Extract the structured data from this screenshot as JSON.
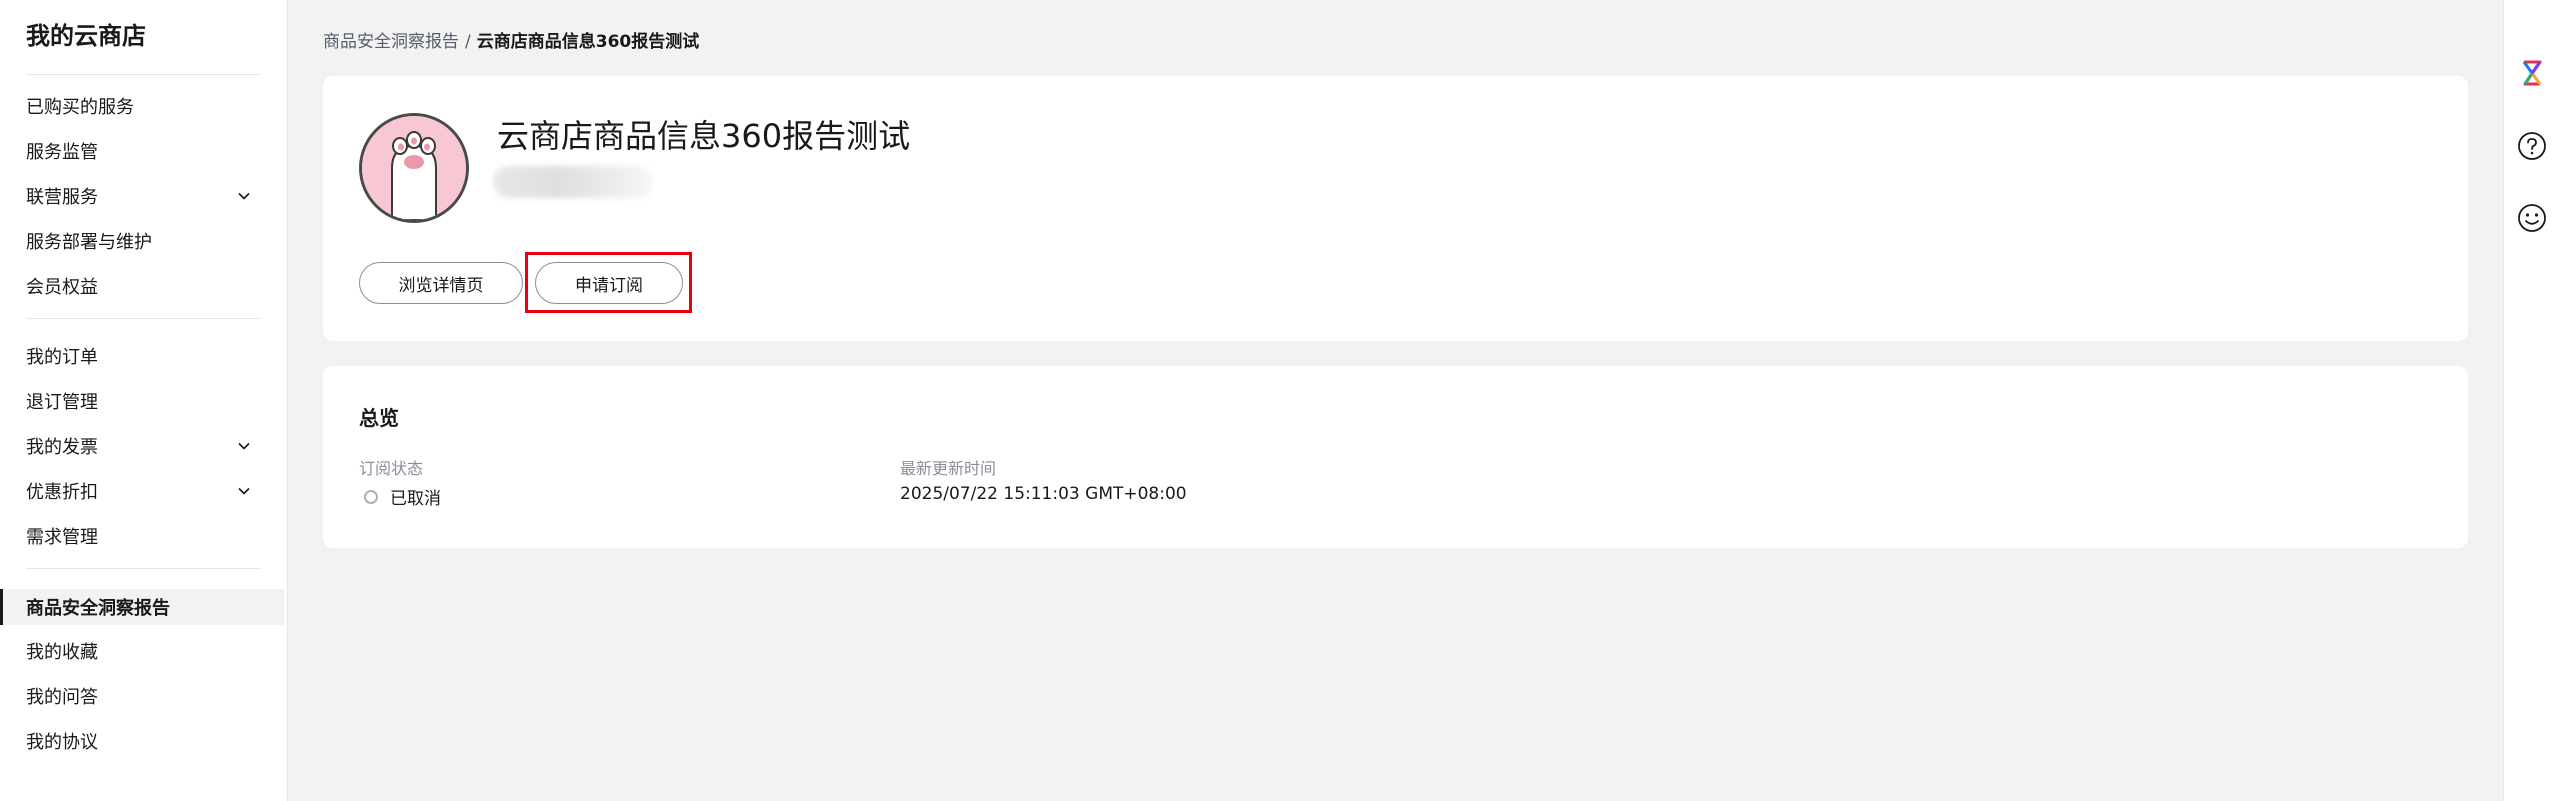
{
  "sidebar": {
    "title": "我的云商店",
    "group1": [
      {
        "label": "已购买的服务",
        "expandable": false
      },
      {
        "label": "服务监管",
        "expandable": false
      },
      {
        "label": "联营服务",
        "expandable": true
      },
      {
        "label": "服务部署与维护",
        "expandable": false
      },
      {
        "label": "会员权益",
        "expandable": false
      }
    ],
    "group2": [
      {
        "label": "我的订单",
        "expandable": false
      },
      {
        "label": "退订管理",
        "expandable": false
      },
      {
        "label": "我的发票",
        "expandable": true
      },
      {
        "label": "优惠折扣",
        "expandable": true
      },
      {
        "label": "需求管理",
        "expandable": false
      }
    ],
    "group3": [
      {
        "label": "商品安全洞察报告",
        "active": true
      },
      {
        "label": "我的收藏",
        "active": false
      },
      {
        "label": "我的问答",
        "active": false
      },
      {
        "label": "我的协议",
        "active": false
      }
    ]
  },
  "breadcrumb": {
    "parent": "商品安全洞察报告",
    "separator": "/",
    "current": "云商店商品信息360报告测试"
  },
  "product": {
    "title": "云商店商品信息360报告测试",
    "browse_label": "浏览详情页",
    "subscribe_label": "申请订阅"
  },
  "overview": {
    "title": "总览",
    "status_label": "订阅状态",
    "status_value": "已取消",
    "updated_label": "最新更新时间",
    "updated_value": "2025/07/22 15:11:03 GMT+08:00"
  },
  "right_rail": {
    "icons": [
      "brand-logo-icon",
      "help-icon",
      "feedback-smile-icon"
    ]
  },
  "colors": {
    "highlight": "#e60012",
    "avatar_bg": "#f7c8d3",
    "page_bg": "#f2f2f2"
  }
}
